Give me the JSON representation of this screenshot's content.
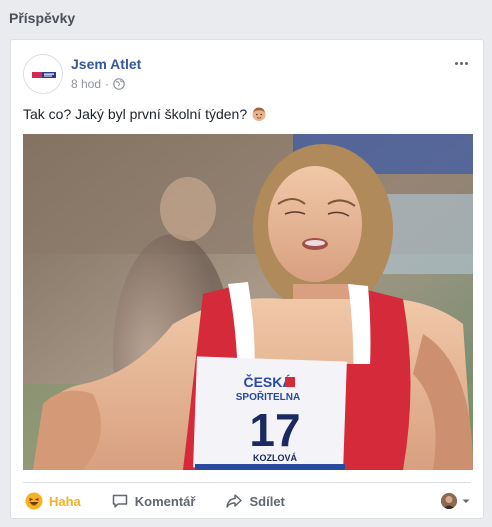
{
  "section": {
    "title": "Příspěvky"
  },
  "post": {
    "page_name": "Jsem Atlet",
    "time": "8 hod",
    "separator": "·",
    "text": "Tak co? Jaký byl první školní týden?",
    "photo": {
      "bib_number": "17",
      "bib_sponsor_line1": "ČESKÁ",
      "bib_sponsor_line2": "SPOŘITELNA",
      "bib_name": "KOZLOVÁ"
    }
  },
  "actions": {
    "reaction_label": "Haha",
    "comment_label": "Komentář",
    "share_label": "Sdílet"
  },
  "colors": {
    "brand": "#365899",
    "haha": "#f7b125",
    "secondary_text": "#90949c"
  },
  "icons": [
    "avatar-logo",
    "globe-icon",
    "more-icon",
    "emoji-icon",
    "haha-icon",
    "comment-icon",
    "share-icon",
    "chevron-down-icon"
  ]
}
